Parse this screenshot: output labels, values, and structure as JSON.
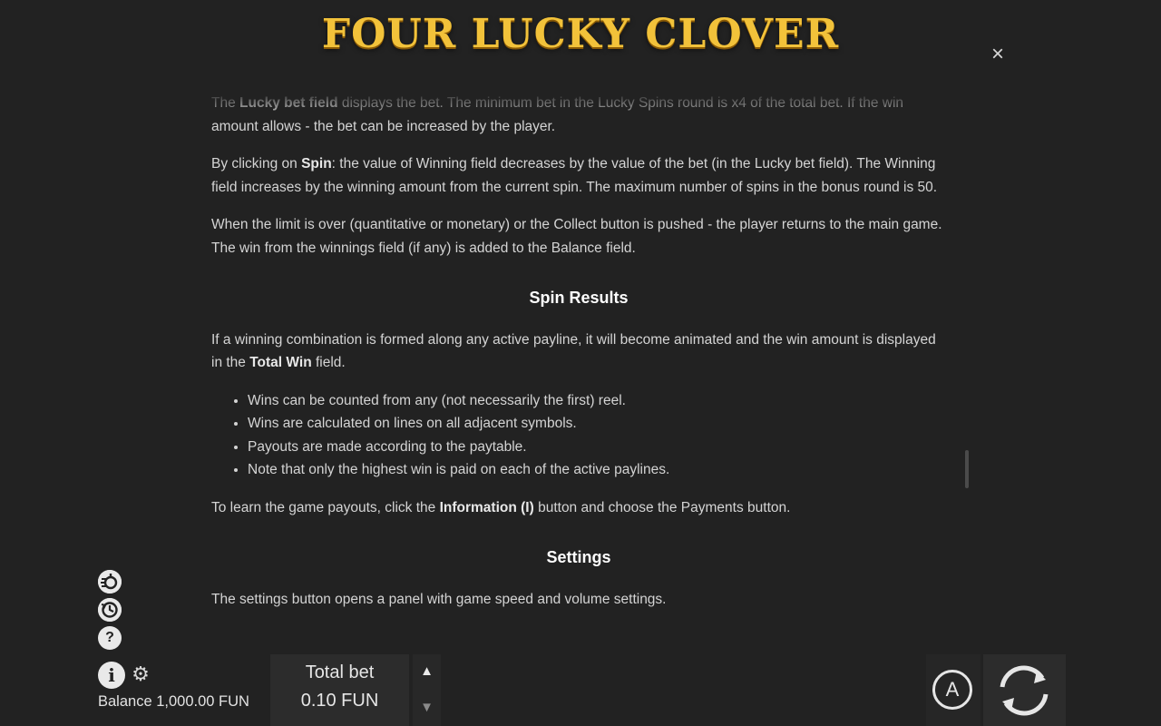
{
  "header": {
    "logo_text": "FOUR LUCKY CLOVER",
    "close_icon": "×"
  },
  "content": {
    "p1": {
      "before": "The ",
      "bold": "Lucky bet field",
      "after": " displays the bet. The minimum bet in the Lucky Spins round is x4 of the total bet. If the win amount allows - the bet can be increased by the player."
    },
    "p2": {
      "before": "By clicking on ",
      "bold": "Spin",
      "after": ": the value of Winning field decreases by the value of the bet (in the Lucky bet field). The Winning field increases by the winning amount from the current spin. The maximum number of spins in the bonus round is 50."
    },
    "p3": "When the limit is over (quantitative or monetary) or the Collect button is pushed - the player returns to the main game. The win from the winnings field (if any) is added to the Balance field.",
    "h_spin_results": "Spin Results",
    "p4": {
      "before": "If a winning combination is formed along any active payline, it will become animated and the win amount is displayed in the ",
      "bold": "Total Win",
      "after": " field."
    },
    "bullets": [
      "Wins can be counted from any (not necessarily the first) reel.",
      "Wins are calculated on lines on all adjacent symbols.",
      "Payouts are made according to the paytable.",
      "Note that only the highest win is paid on each of the active paylines."
    ],
    "p5": {
      "before": "To learn the game payouts, click the ",
      "bold": "Information (I)",
      "after": " button and choose the Payments button."
    },
    "h_settings": "Settings",
    "p6": "The settings button opens a panel with game speed and volume settings."
  },
  "footer": {
    "balance": "Balance 1,000.00 FUN",
    "total_bet_label": "Total bet",
    "total_bet_value": "0.10 FUN",
    "arrow_up": "▲",
    "arrow_down": "▼",
    "auto_label": "A",
    "help_icon": "?",
    "info_icon": "i",
    "gear_icon": "⚙"
  }
}
